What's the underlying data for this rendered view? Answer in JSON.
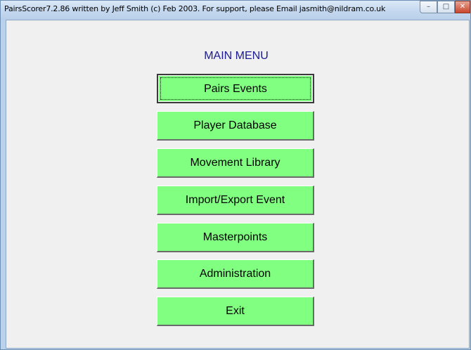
{
  "window": {
    "title": "PairsScorer7.2.86 written by Jeff Smith (c) Feb 2003.  For support, please Email jasmith@nildram.co.uk",
    "minimize_glyph": "–",
    "maximize_glyph": "□",
    "close_glyph": "✕"
  },
  "main_menu": {
    "heading": "MAIN MENU",
    "focused_item": "Pairs Events",
    "items": [
      {
        "label": "Pairs Events"
      },
      {
        "label": "Player Database"
      },
      {
        "label": "Movement Library"
      },
      {
        "label": "Import/Export Event"
      },
      {
        "label": "Masterpoints"
      },
      {
        "label": "Administration"
      },
      {
        "label": "Exit"
      }
    ]
  },
  "colors": {
    "button_face": "#80ff80",
    "heading_text": "#1b1b8f",
    "window_frame": "#b9d1ea"
  }
}
